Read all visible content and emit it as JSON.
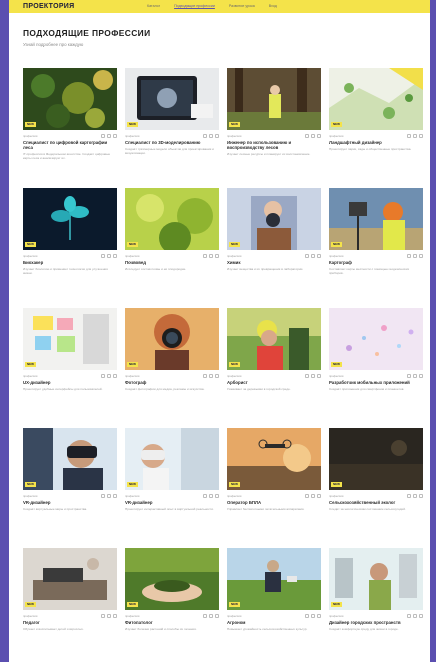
{
  "header": {
    "logo_main": "ПРОЕКТОРИЯ",
    "nav": [
      {
        "label": "Каталог",
        "active": false
      },
      {
        "label": "Подходящие профессии",
        "active": true
      },
      {
        "label": "Развитие урока",
        "active": false
      },
      {
        "label": "Вход",
        "active": false
      }
    ]
  },
  "page": {
    "title": "ПОДХОДЯЩИЕ ПРОФЕССИИ",
    "subtitle": "Узнай подробнее про каждую"
  },
  "cards": [
    {
      "name": "Специалист по цифровой картографии леса",
      "desc": "IT-профессия в Федеральном агентстве. Создаёт цифровые карты леса и анализирует их.",
      "tag": "NEW",
      "meta": "профессия",
      "scene": "forest-map"
    },
    {
      "name": "Специалист по 3D-моделированию",
      "desc": "Создаёт трёхмерные модели объектов для проектирования и визуализации.",
      "tag": "NEW",
      "meta": "профессия",
      "scene": "tablet-3d"
    },
    {
      "name": "Инженер по использованию и воспроизводству лесов",
      "desc": "Изучает лесные ресурсы и планирует их восстановление.",
      "tag": "NEW",
      "meta": "профессия",
      "scene": "forest-engineer"
    },
    {
      "name": "Ландшафтный дизайнер",
      "desc": "Проектирует парки, сады и общественные пространства.",
      "tag": "NEW",
      "meta": "профессия",
      "scene": "landscape-plan"
    },
    {
      "name": "Биохакер",
      "desc": "Изучает биологию и применяет технологии для улучшения жизни.",
      "tag": "NEW",
      "meta": "профессия",
      "scene": "bio-plant"
    },
    {
      "name": "Почвовед",
      "desc": "Исследует состав почвы и её плодородие.",
      "tag": "NEW",
      "meta": "профессия",
      "scene": "soil"
    },
    {
      "name": "Химик",
      "desc": "Изучает вещества и их превращения в лаборатории.",
      "tag": "NEW",
      "meta": "профессия",
      "scene": "chemist"
    },
    {
      "name": "Картограф",
      "desc": "Составляет карты местности с помощью геодезических приборов.",
      "tag": "NEW",
      "meta": "профессия",
      "scene": "surveyor"
    },
    {
      "name": "UX-дизайнер",
      "desc": "Проектирует удобные интерфейсы для пользователей.",
      "tag": "NEW",
      "meta": "профессия",
      "scene": "ux-board"
    },
    {
      "name": "Фотограф",
      "desc": "Создаёт фотографии для медиа, рекламы и искусства.",
      "tag": "NEW",
      "meta": "профессия",
      "scene": "photographer"
    },
    {
      "name": "Арборист",
      "desc": "Ухаживает за деревьями в городской среде.",
      "tag": "NEW",
      "meta": "профессия",
      "scene": "arborist"
    },
    {
      "name": "Разработчик мобильных приложений",
      "desc": "Создаёт приложения для смартфонов и планшетов.",
      "tag": "NEW",
      "meta": "профессия",
      "scene": "mobile-dev"
    },
    {
      "name": "VR-дизайнер",
      "desc": "Создаёт виртуальные миры и пространства.",
      "tag": "NEW",
      "meta": "профессия",
      "scene": "vr-man"
    },
    {
      "name": "VR-дизайнер",
      "desc": "Проектирует интерактивный опыт в виртуальной реальности.",
      "tag": "NEW",
      "meta": "профессия",
      "scene": "vr-woman"
    },
    {
      "name": "Оператор БПЛА",
      "desc": "Управляет беспилотными летательными аппаратами.",
      "tag": "NEW",
      "meta": "профессия",
      "scene": "drone"
    },
    {
      "name": "Сельскохозяйственный эколог",
      "desc": "Следит за экологическим состоянием сельхозугодий.",
      "tag": "NEW",
      "meta": "профессия",
      "scene": "agro-dark"
    },
    {
      "name": "Педагог",
      "desc": "Обучает и воспитывает детей и взрослых.",
      "tag": "NEW",
      "meta": "профессия",
      "scene": "teacher-desk"
    },
    {
      "name": "Фитопатолог",
      "desc": "Изучает болезни растений и способы их лечения.",
      "tag": "NEW",
      "meta": "профессия",
      "scene": "moss-hands"
    },
    {
      "name": "Агроном",
      "desc": "Повышает урожайность сельскохозяйственных культур.",
      "tag": "NEW",
      "meta": "профессия",
      "scene": "agronomist"
    },
    {
      "name": "Дизайнер городских пространств",
      "desc": "Создаёт комфортную среду для жизни в городе.",
      "tag": "NEW",
      "meta": "профессия",
      "scene": "city-designer"
    }
  ]
}
